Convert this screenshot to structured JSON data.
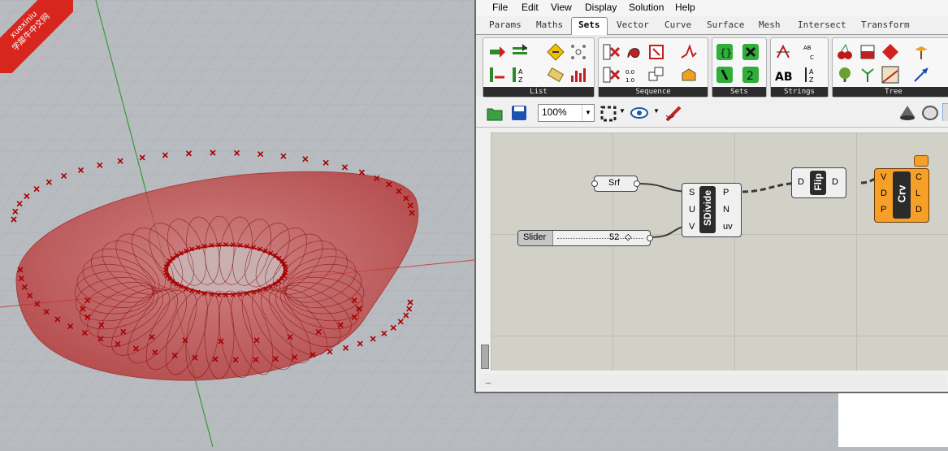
{
  "watermark": {
    "line1": "xuexiniu",
    "line2": "学犀牛中文网"
  },
  "menu": [
    "File",
    "Edit",
    "View",
    "Display",
    "Solution",
    "Help"
  ],
  "tabs": [
    "Params",
    "Maths",
    "Sets",
    "Vector",
    "Curve",
    "Surface",
    "Mesh",
    "Intersect",
    "Transform"
  ],
  "active_tab": "Sets",
  "ribbon_groups": [
    "List",
    "Sequence",
    "Sets",
    "Strings",
    "Tree"
  ],
  "toolbar": {
    "zoom": "100%"
  },
  "canvas": {
    "srf_param": {
      "label": "Srf"
    },
    "slider": {
      "label": "Slider",
      "value": "52"
    },
    "sdivide": {
      "name": "SDivide",
      "inputs": [
        "S",
        "U",
        "V"
      ],
      "outputs": [
        "P",
        "N",
        "uv"
      ]
    },
    "flip": {
      "name": "Flip",
      "input": "D",
      "output": "D"
    },
    "crv": {
      "name": "Crv",
      "inputs": [
        "V",
        "D",
        "P"
      ],
      "outputs": [
        "C",
        "L",
        "D"
      ]
    }
  },
  "status": {
    "text": "_"
  },
  "colors": {
    "surface": "#c21b1b",
    "points": "#b00000",
    "component": "#f0f0f0",
    "selected": "#f7a029"
  }
}
